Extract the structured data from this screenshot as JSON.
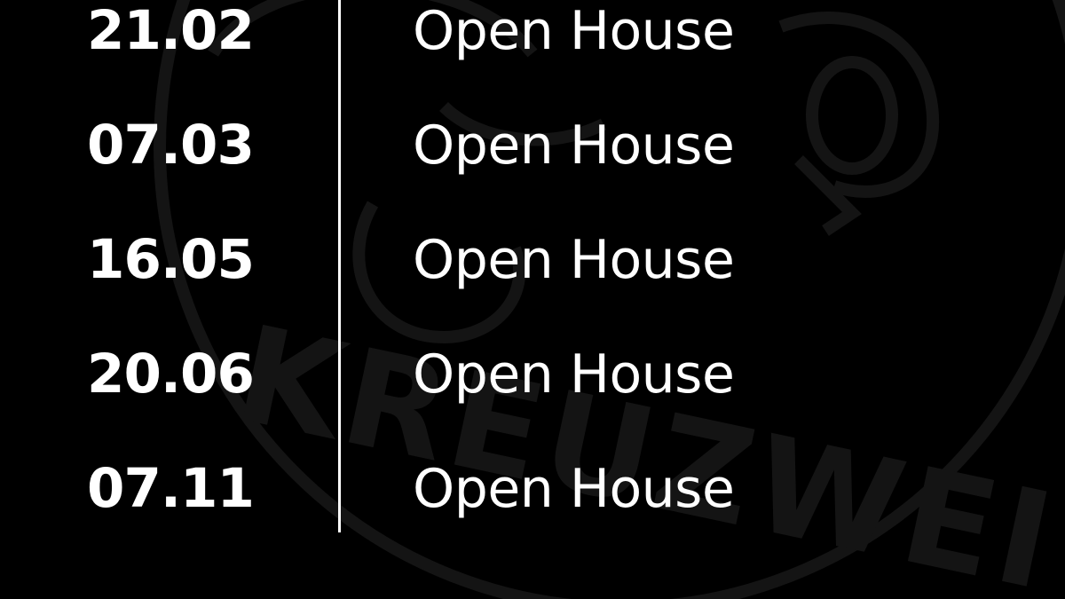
{
  "colors": {
    "background": "#000000",
    "text": "#ffffff",
    "watermark": "#141414"
  },
  "watermark": {
    "icon": "kreuzwerk-seal-icon",
    "text": "KREUZWEI"
  },
  "events": [
    {
      "date": "21.02",
      "title": "Open House"
    },
    {
      "date": "07.03",
      "title": "Open House"
    },
    {
      "date": "16.05",
      "title": "Open House"
    },
    {
      "date": "20.06",
      "title": "Open House"
    },
    {
      "date": "07.11",
      "title": "Open House"
    }
  ]
}
